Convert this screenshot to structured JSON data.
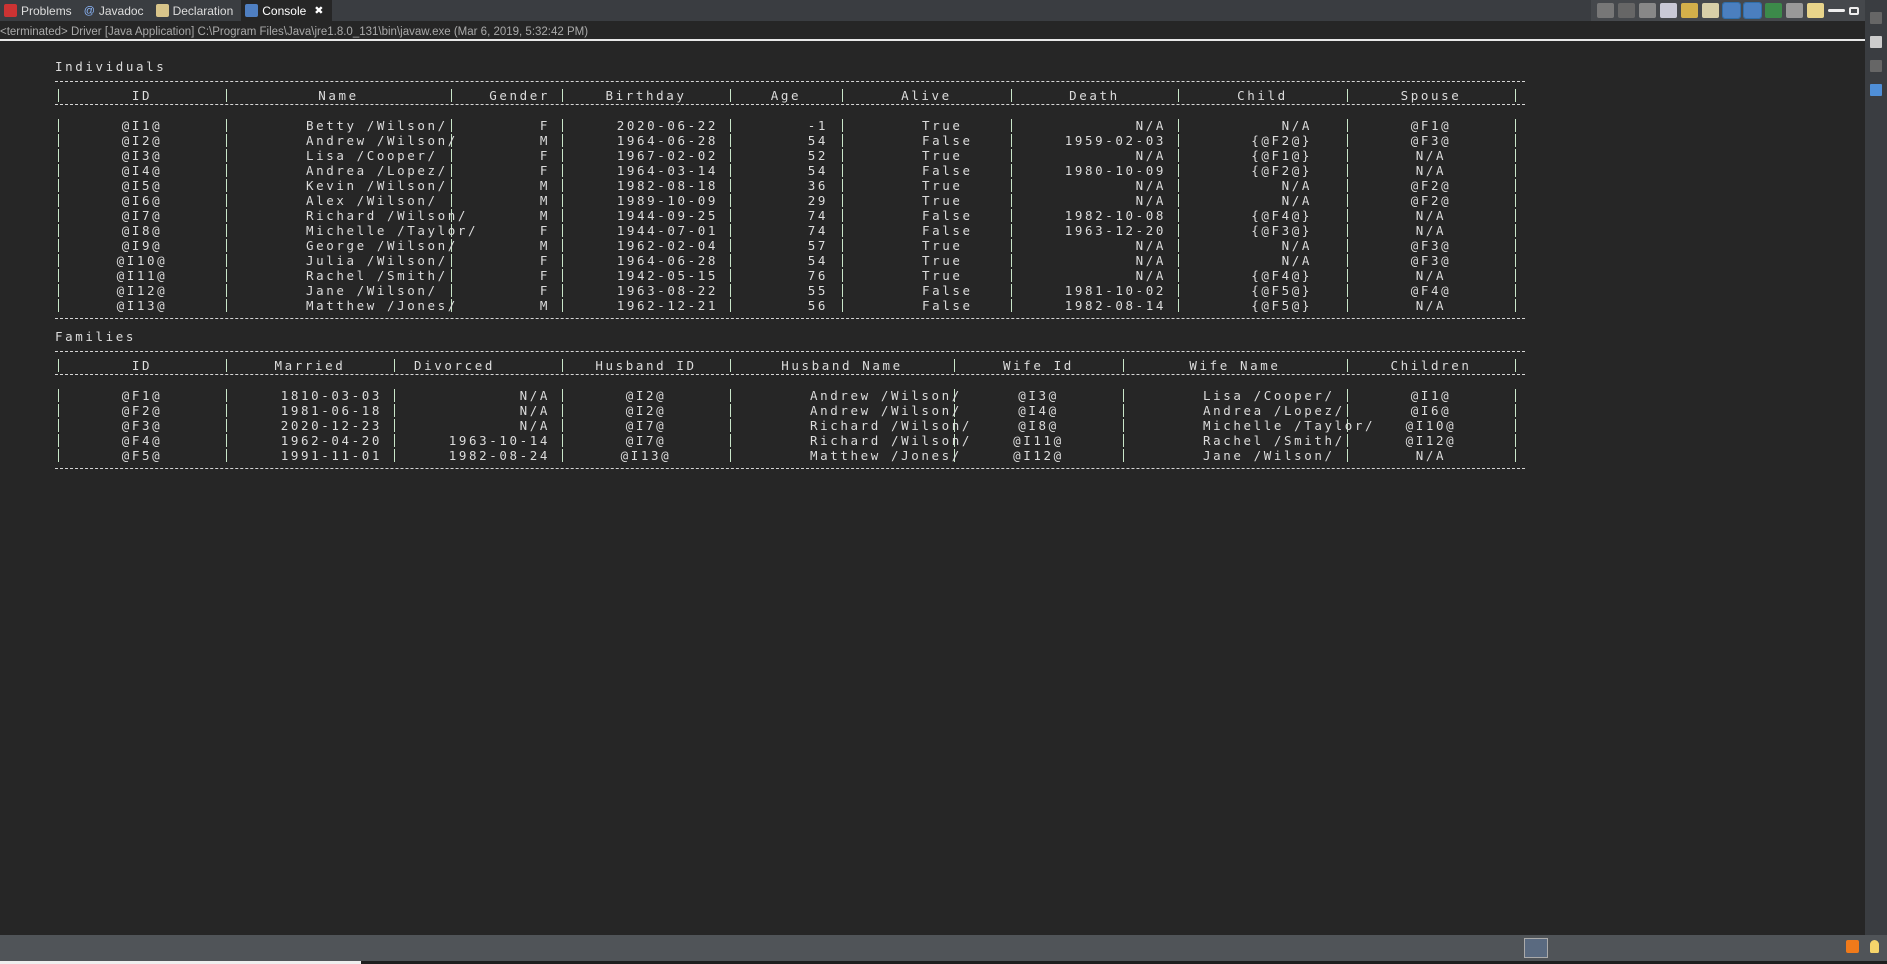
{
  "tabs": [
    {
      "label": "Problems",
      "icon": "problems-icon",
      "active": false
    },
    {
      "label": "Javadoc",
      "icon": "javadoc-icon",
      "active": false
    },
    {
      "label": "Declaration",
      "icon": "declaration-icon",
      "active": false
    },
    {
      "label": "Console",
      "icon": "console-icon",
      "active": true
    }
  ],
  "close_icon": "✖",
  "status": "<terminated> Driver [Java Application] C:\\Program Files\\Java\\jre1.8.0_131\\bin\\javaw.exe (Mar 6, 2019, 5:32:42 PM)",
  "toolbar": [
    "terminate-icon",
    "remove-launch-icon",
    "remove-all-terminated-icon",
    "clear-console-icon",
    "scroll-lock-icon",
    "word-wrap-icon",
    "show-on-stdout-icon",
    "show-on-stderr-icon",
    "pin-console-icon",
    "display-console-icon",
    "open-console-icon",
    "minimize-icon",
    "maximize-icon"
  ],
  "individuals": {
    "title": "Individuals",
    "headers": [
      "ID",
      "Name",
      "Gender",
      "Birthday",
      "Age",
      "Alive",
      "Death",
      "Child",
      "Spouse"
    ],
    "rows": [
      [
        "@I1@",
        "Betty /Wilson/",
        "F",
        "2020-06-22",
        "-1",
        "True",
        "N/A",
        "N/A",
        "@F1@"
      ],
      [
        "@I2@",
        "Andrew /Wilson/",
        "M",
        "1964-06-28",
        "54",
        "False",
        "1959-02-03",
        "{@F2@}",
        "@F3@"
      ],
      [
        "@I3@",
        "Lisa /Cooper/",
        "F",
        "1967-02-02",
        "52",
        "True",
        "N/A",
        "{@F1@}",
        "N/A"
      ],
      [
        "@I4@",
        "Andrea /Lopez/",
        "F",
        "1964-03-14",
        "54",
        "False",
        "1980-10-09",
        "{@F2@}",
        "N/A"
      ],
      [
        "@I5@",
        "Kevin /Wilson/",
        "M",
        "1982-08-18",
        "36",
        "True",
        "N/A",
        "N/A",
        "@F2@"
      ],
      [
        "@I6@",
        "Alex /Wilson/",
        "M",
        "1989-10-09",
        "29",
        "True",
        "N/A",
        "N/A",
        "@F2@"
      ],
      [
        "@I7@",
        "Richard /Wilson/",
        "M",
        "1944-09-25",
        "74",
        "False",
        "1982-10-08",
        "{@F4@}",
        "N/A"
      ],
      [
        "@I8@",
        "Michelle /Taylor/",
        "F",
        "1944-07-01",
        "74",
        "False",
        "1963-12-20",
        "{@F3@}",
        "N/A"
      ],
      [
        "@I9@",
        "George /Wilson/",
        "M",
        "1962-02-04",
        "57",
        "True",
        "N/A",
        "N/A",
        "@F3@"
      ],
      [
        "@I10@",
        "Julia /Wilson/",
        "F",
        "1964-06-28",
        "54",
        "True",
        "N/A",
        "N/A",
        "@F3@"
      ],
      [
        "@I11@",
        "Rachel /Smith/",
        "F",
        "1942-05-15",
        "76",
        "True",
        "N/A",
        "{@F4@}",
        "N/A"
      ],
      [
        "@I12@",
        "Jane /Wilson/",
        "F",
        "1963-08-22",
        "55",
        "False",
        "1981-10-02",
        "{@F5@}",
        "@F4@"
      ],
      [
        "@I13@",
        "Matthew /Jones/",
        "M",
        "1962-12-21",
        "56",
        "False",
        "1982-08-14",
        "{@F5@}",
        "N/A"
      ]
    ]
  },
  "families": {
    "title": "Families",
    "headers": [
      "ID",
      "Married",
      "Divorced",
      "Husband ID",
      "Husband Name",
      "Wife Id",
      "Wife Name",
      "Children"
    ],
    "rows": [
      [
        "@F1@",
        "1810-03-03",
        "N/A",
        "@I2@",
        "Andrew /Wilson/",
        "@I3@",
        "Lisa /Cooper/",
        "@I1@"
      ],
      [
        "@F2@",
        "1981-06-18",
        "N/A",
        "@I2@",
        "Andrew /Wilson/",
        "@I4@",
        "Andrea /Lopez/",
        "@I6@"
      ],
      [
        "@F3@",
        "2020-12-23",
        "N/A",
        "@I7@",
        "Richard /Wilson/",
        "@I8@",
        "Michelle /Taylor/",
        "@I10@"
      ],
      [
        "@F4@",
        "1962-04-20",
        "1963-10-14",
        "@I7@",
        "Richard /Wilson/",
        "@I11@",
        "Rachel /Smith/",
        "@I12@"
      ],
      [
        "@F5@",
        "1991-11-01",
        "1982-08-24",
        "@I13@",
        "Matthew /Jones/",
        "@I12@",
        "Jane /Wilson/",
        "N/A"
      ]
    ]
  },
  "statusbar_icons": [
    "progress-view-icon",
    "rss-feed-icon",
    "tip-lightbulb-icon"
  ]
}
